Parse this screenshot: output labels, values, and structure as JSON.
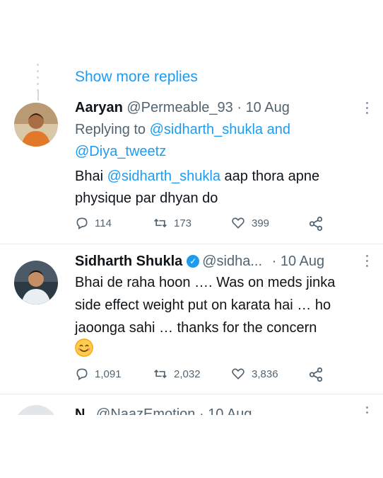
{
  "show_more": "Show more replies",
  "tweets": [
    {
      "name": "Aaryan",
      "handle": "@Permeable_93",
      "dot": "·",
      "time": "10 Aug",
      "replying_prefix": "Replying to",
      "replying_user1": "@sidharth_shukla",
      "replying_and": "and",
      "replying_user2": "@Diya_tweetz",
      "text_line1_prefix": "Bhai",
      "text_line1_mention": "@sidharth_shukla",
      "text_line1_suffix": "aap thora apne",
      "text_line2": "physique par dhyan do",
      "replies": "114",
      "retweets": "173",
      "likes": "399"
    },
    {
      "name": "Sidharth Shukla",
      "verified_icon": "verified-badge-icon",
      "handle": "@sidha...",
      "dot": "·",
      "time": "10 Aug",
      "text_line1": "Bhai de raha hoon …. Was on meds jinka",
      "text_line2": "side effect weight put on karata hai … ho",
      "text_line3": "jaoonga sahi … thanks for the concern",
      "emoji": "smiling-face-emoji",
      "replies": "1,091",
      "retweets": "2,032",
      "likes": "3,836"
    },
    {
      "name": "N",
      "handle": "@NaazEmotion",
      "dot": "·",
      "time": "10 Aug"
    }
  ],
  "colors": {
    "accent": "#1d9bf0",
    "text": "#0f1419",
    "muted": "#536471"
  }
}
